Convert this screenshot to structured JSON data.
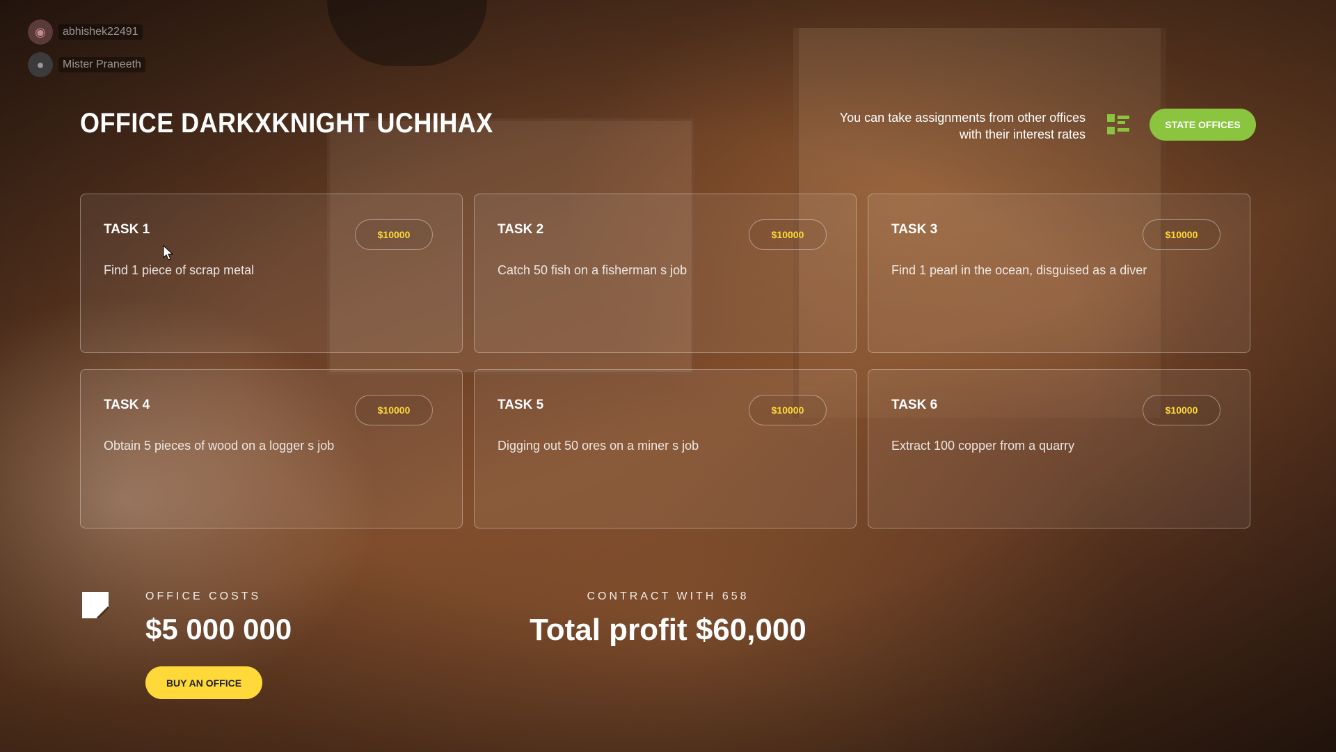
{
  "users": [
    {
      "name": "abhishek22491",
      "avatar_icon": "discord-icon"
    },
    {
      "name": "Mister Praneeth",
      "avatar_icon": "avatar-icon"
    }
  ],
  "office": {
    "title": "OFFICE DARKXKNIGHT UCHIHAX"
  },
  "assignments_note": {
    "line1": "You can take assignments from other offices",
    "line2": "with their interest rates"
  },
  "state_offices_button": "STATE OFFICES",
  "tasks": [
    {
      "title": "TASK 1",
      "price": "$10000",
      "description": "Find 1 piece of scrap metal"
    },
    {
      "title": "TASK 2",
      "price": "$10000",
      "description": "Catch 50 fish on a fisherman s job"
    },
    {
      "title": "TASK 3",
      "price": "$10000",
      "description": "Find 1 pearl in the ocean, disguised as a diver"
    },
    {
      "title": "TASK 4",
      "price": "$10000",
      "description": "Obtain 5 pieces of wood on a logger s job"
    },
    {
      "title": "TASK 5",
      "price": "$10000",
      "description": "Digging out 50 ores on a miner s job"
    },
    {
      "title": "TASK 6",
      "price": "$10000",
      "description": "Extract 100 copper from a quarry"
    }
  ],
  "costs": {
    "label": "OFFICE COSTS",
    "value": "$5 000 000",
    "buy_label": "BUY AN OFFICE"
  },
  "contract": {
    "label": "CONTRACT WITH 658",
    "total_profit": "Total profit $60,000"
  },
  "colors": {
    "accent_green": "#8bc53f",
    "accent_yellow": "#ffd93a"
  }
}
